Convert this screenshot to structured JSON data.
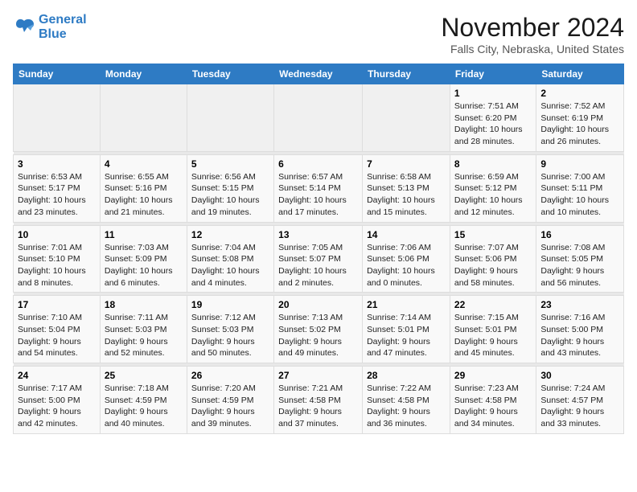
{
  "logo": {
    "line1": "General",
    "line2": "Blue"
  },
  "title": "November 2024",
  "subtitle": "Falls City, Nebraska, United States",
  "days_of_week": [
    "Sunday",
    "Monday",
    "Tuesday",
    "Wednesday",
    "Thursday",
    "Friday",
    "Saturday"
  ],
  "weeks": [
    [
      {
        "day": "",
        "info": ""
      },
      {
        "day": "",
        "info": ""
      },
      {
        "day": "",
        "info": ""
      },
      {
        "day": "",
        "info": ""
      },
      {
        "day": "",
        "info": ""
      },
      {
        "day": "1",
        "info": "Sunrise: 7:51 AM\nSunset: 6:20 PM\nDaylight: 10 hours and 28 minutes."
      },
      {
        "day": "2",
        "info": "Sunrise: 7:52 AM\nSunset: 6:19 PM\nDaylight: 10 hours and 26 minutes."
      }
    ],
    [
      {
        "day": "3",
        "info": "Sunrise: 6:53 AM\nSunset: 5:17 PM\nDaylight: 10 hours and 23 minutes."
      },
      {
        "day": "4",
        "info": "Sunrise: 6:55 AM\nSunset: 5:16 PM\nDaylight: 10 hours and 21 minutes."
      },
      {
        "day": "5",
        "info": "Sunrise: 6:56 AM\nSunset: 5:15 PM\nDaylight: 10 hours and 19 minutes."
      },
      {
        "day": "6",
        "info": "Sunrise: 6:57 AM\nSunset: 5:14 PM\nDaylight: 10 hours and 17 minutes."
      },
      {
        "day": "7",
        "info": "Sunrise: 6:58 AM\nSunset: 5:13 PM\nDaylight: 10 hours and 15 minutes."
      },
      {
        "day": "8",
        "info": "Sunrise: 6:59 AM\nSunset: 5:12 PM\nDaylight: 10 hours and 12 minutes."
      },
      {
        "day": "9",
        "info": "Sunrise: 7:00 AM\nSunset: 5:11 PM\nDaylight: 10 hours and 10 minutes."
      }
    ],
    [
      {
        "day": "10",
        "info": "Sunrise: 7:01 AM\nSunset: 5:10 PM\nDaylight: 10 hours and 8 minutes."
      },
      {
        "day": "11",
        "info": "Sunrise: 7:03 AM\nSunset: 5:09 PM\nDaylight: 10 hours and 6 minutes."
      },
      {
        "day": "12",
        "info": "Sunrise: 7:04 AM\nSunset: 5:08 PM\nDaylight: 10 hours and 4 minutes."
      },
      {
        "day": "13",
        "info": "Sunrise: 7:05 AM\nSunset: 5:07 PM\nDaylight: 10 hours and 2 minutes."
      },
      {
        "day": "14",
        "info": "Sunrise: 7:06 AM\nSunset: 5:06 PM\nDaylight: 10 hours and 0 minutes."
      },
      {
        "day": "15",
        "info": "Sunrise: 7:07 AM\nSunset: 5:06 PM\nDaylight: 9 hours and 58 minutes."
      },
      {
        "day": "16",
        "info": "Sunrise: 7:08 AM\nSunset: 5:05 PM\nDaylight: 9 hours and 56 minutes."
      }
    ],
    [
      {
        "day": "17",
        "info": "Sunrise: 7:10 AM\nSunset: 5:04 PM\nDaylight: 9 hours and 54 minutes."
      },
      {
        "day": "18",
        "info": "Sunrise: 7:11 AM\nSunset: 5:03 PM\nDaylight: 9 hours and 52 minutes."
      },
      {
        "day": "19",
        "info": "Sunrise: 7:12 AM\nSunset: 5:03 PM\nDaylight: 9 hours and 50 minutes."
      },
      {
        "day": "20",
        "info": "Sunrise: 7:13 AM\nSunset: 5:02 PM\nDaylight: 9 hours and 49 minutes."
      },
      {
        "day": "21",
        "info": "Sunrise: 7:14 AM\nSunset: 5:01 PM\nDaylight: 9 hours and 47 minutes."
      },
      {
        "day": "22",
        "info": "Sunrise: 7:15 AM\nSunset: 5:01 PM\nDaylight: 9 hours and 45 minutes."
      },
      {
        "day": "23",
        "info": "Sunrise: 7:16 AM\nSunset: 5:00 PM\nDaylight: 9 hours and 43 minutes."
      }
    ],
    [
      {
        "day": "24",
        "info": "Sunrise: 7:17 AM\nSunset: 5:00 PM\nDaylight: 9 hours and 42 minutes."
      },
      {
        "day": "25",
        "info": "Sunrise: 7:18 AM\nSunset: 4:59 PM\nDaylight: 9 hours and 40 minutes."
      },
      {
        "day": "26",
        "info": "Sunrise: 7:20 AM\nSunset: 4:59 PM\nDaylight: 9 hours and 39 minutes."
      },
      {
        "day": "27",
        "info": "Sunrise: 7:21 AM\nSunset: 4:58 PM\nDaylight: 9 hours and 37 minutes."
      },
      {
        "day": "28",
        "info": "Sunrise: 7:22 AM\nSunset: 4:58 PM\nDaylight: 9 hours and 36 minutes."
      },
      {
        "day": "29",
        "info": "Sunrise: 7:23 AM\nSunset: 4:58 PM\nDaylight: 9 hours and 34 minutes."
      },
      {
        "day": "30",
        "info": "Sunrise: 7:24 AM\nSunset: 4:57 PM\nDaylight: 9 hours and 33 minutes."
      }
    ]
  ]
}
